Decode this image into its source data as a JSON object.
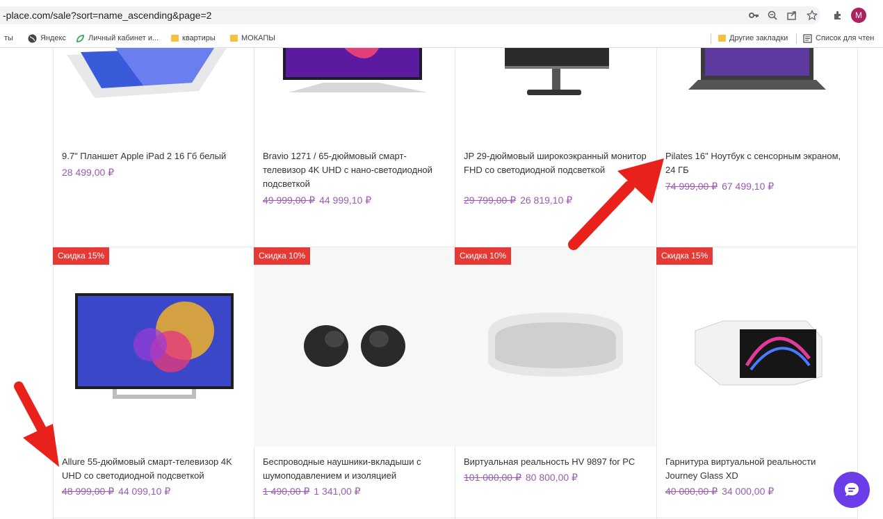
{
  "browser": {
    "url": "-place.com/sale?sort=name_ascending&page=2",
    "avatar_letter": "M",
    "bookmarks": [
      {
        "label": "ты",
        "icon": "cut-label"
      },
      {
        "label": "Яндекс",
        "icon": "globe-icon"
      },
      {
        "label": "Личный кабинет и...",
        "icon": "leaf-icon"
      },
      {
        "label": "квартиры",
        "icon": "folder-icon"
      },
      {
        "label": "МОКАПЫ",
        "icon": "folder-icon"
      }
    ],
    "other_bookmarks": "Другие закладки",
    "reading_list": "Список для чтен"
  },
  "products_row1": [
    {
      "title": "9.7\" Планшет Apple iPad 2 16 Гб белый",
      "price": "28 499,00 ₽",
      "old_price": ""
    },
    {
      "title": "Bravio 1271 / 65-дюймовый смарт-телевизор 4K UHD с нано-светодиодной подсветкой",
      "old_price": "49 999,00 ₽",
      "price": "44 999,10 ₽"
    },
    {
      "title": "JP 29-дюймовый широкоэкранный монитор FHD со светодиодной подсветкой",
      "old_price": "29 799,00 ₽",
      "price": "26 819,10 ₽"
    },
    {
      "title": "Pilates 16\" Ноутбук с сенсорным экраном, 24 ГБ",
      "old_price": "74 999,00 ₽",
      "price": "67 499,10 ₽"
    }
  ],
  "products_row2": [
    {
      "badge": "Скидка 15%",
      "title": "Allure 55-дюймовый смарт-телевизор 4K UHD со светодиодной подсветкой",
      "old_price": "48 999,00 ₽",
      "price": "44 099,10 ₽"
    },
    {
      "badge": "Скидка 10%",
      "title": "Беспроводные наушники-вкладыши с шумоподавлением и изоляцией",
      "old_price": "1 490,00 ₽",
      "price": "1 341,00 ₽"
    },
    {
      "badge": "Скидка 10%",
      "title": "Виртуальная реальность HV 9897 for PC",
      "old_price": "101 000,00 ₽",
      "price": "80 800,00 ₽"
    },
    {
      "badge": "Скидка 15%",
      "title": "Гарнитура виртуальной реальности Journey Glass XD",
      "old_price": "40 000,00 ₽",
      "price": "34 000,00 ₽"
    }
  ],
  "colors": {
    "price": "#9b59b6",
    "badge": "#e53935",
    "chat": "#6a3de8",
    "arrow": "#e8221b"
  }
}
